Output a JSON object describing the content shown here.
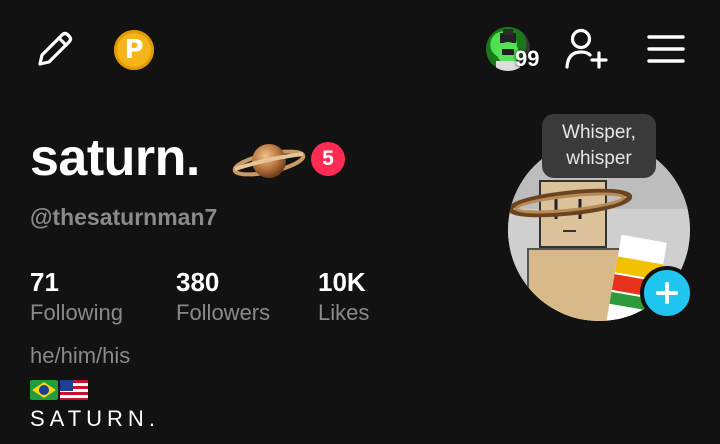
{
  "header": {
    "edit_icon": "pencil-icon",
    "coin_icon": "coin-icon",
    "coin_letter": "P",
    "notification_count": "99",
    "add_friend_icon": "add-user-icon",
    "menu_icon": "hamburger-menu-icon"
  },
  "profile": {
    "display_name": "saturn.",
    "name_emoji": "ringed-planet",
    "badge_count": "5",
    "handle": "@thesaturnman7",
    "tooltip": "Whisper, whisper"
  },
  "stats": [
    {
      "value": "71",
      "label": "Following"
    },
    {
      "value": "380",
      "label": "Followers"
    },
    {
      "value": "10K",
      "label": "Likes"
    }
  ],
  "bio": {
    "pronouns": "he/him/his",
    "flags": [
      "brazil-flag",
      "usa-flag"
    ],
    "line": "SATURN."
  },
  "colors": {
    "background": "#121212",
    "text_primary": "#ffffff",
    "text_secondary": "#8a8a8a",
    "badge": "#fe2c55",
    "coin": "#f4b41a",
    "add_story": "#20c5f0",
    "tooltip_bg": "#3a3a3a"
  }
}
